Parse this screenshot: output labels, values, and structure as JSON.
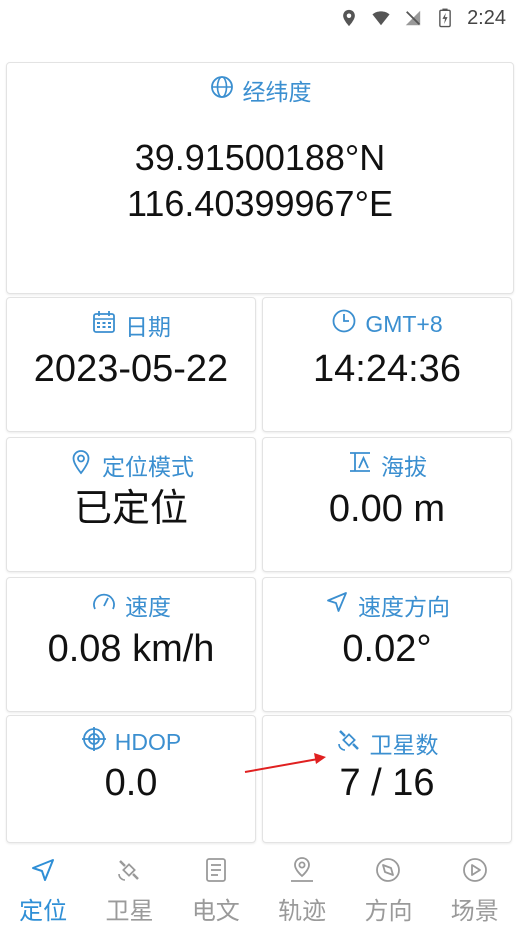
{
  "status_bar": {
    "time": "2:24"
  },
  "cards": {
    "latlon": {
      "label": "经纬度",
      "lat": "39.91500188°N",
      "lon": "116.40399967°E"
    },
    "date": {
      "label": "日期",
      "value": "2023-05-22"
    },
    "timezone": {
      "label": "GMT+8",
      "value": "14:24:36"
    },
    "mode": {
      "label": "定位模式",
      "value": "已定位"
    },
    "altitude": {
      "label": "海拔",
      "value": "0.00 m"
    },
    "speed": {
      "label": "速度",
      "value": "0.08 km/h"
    },
    "direction": {
      "label": "速度方向",
      "value": "0.02°"
    },
    "hdop": {
      "label": "HDOP",
      "value": "0.0"
    },
    "satellites": {
      "label": "卫星数",
      "value": "7 / 16"
    }
  },
  "nav": [
    {
      "label": "定位",
      "icon": "navigation-arrow-icon",
      "active": true
    },
    {
      "label": "卫星",
      "icon": "satellite-icon"
    },
    {
      "label": "电文",
      "icon": "document-icon"
    },
    {
      "label": "轨迹",
      "icon": "location-pin-icon"
    },
    {
      "label": "方向",
      "icon": "compass-icon"
    },
    {
      "label": "场景",
      "icon": "play-circle-icon"
    }
  ],
  "colors": {
    "accent": "#3b8fd0",
    "nav_active": "#2f8fd6",
    "nav_inactive": "#9a9a9a",
    "annotation_arrow": "#e02020"
  }
}
